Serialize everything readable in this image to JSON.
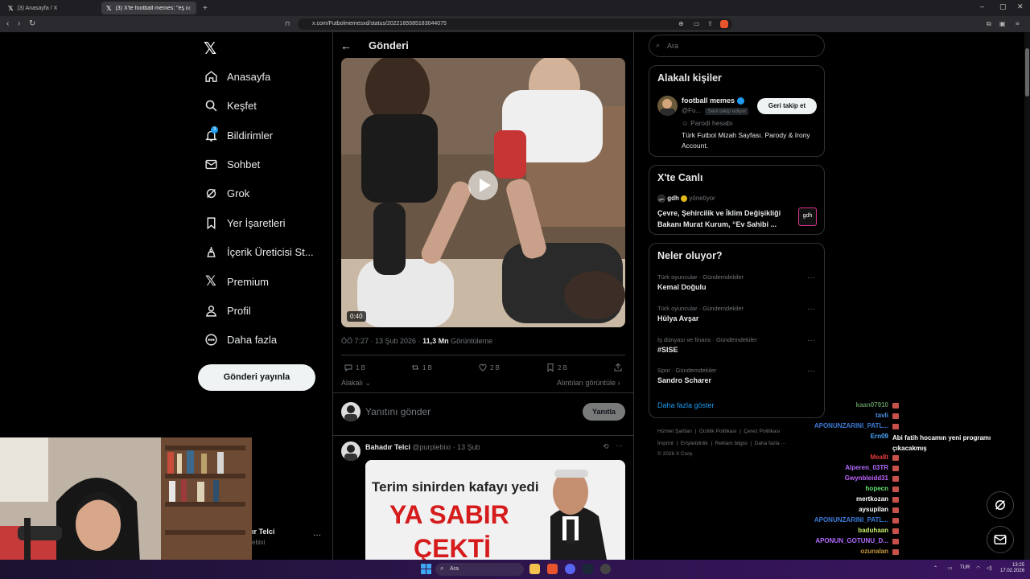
{
  "browser": {
    "tabs": [
      {
        "title": "(3) Anasayfa / X"
      },
      {
        "title": "(3) X'te football memes: \"eş değ..."
      }
    ],
    "url": "x.com/Futbolmemesxd/status/2022165585183044075"
  },
  "nav": {
    "items": [
      {
        "label": "Anasayfa",
        "icon": "home-icon"
      },
      {
        "label": "Keşfet",
        "icon": "search-icon"
      },
      {
        "label": "Bildirimler",
        "icon": "bell-icon"
      },
      {
        "label": "Sohbet",
        "icon": "mail-icon"
      },
      {
        "label": "Grok",
        "icon": "grok-icon"
      },
      {
        "label": "Yer İşaretleri",
        "icon": "bookmark-icon"
      },
      {
        "label": "İçerik Üreticisi St...",
        "icon": "creator-icon"
      },
      {
        "label": "Premium",
        "icon": "x-logo-icon"
      },
      {
        "label": "Profil",
        "icon": "person-icon"
      },
      {
        "label": "Daha fazla",
        "icon": "more-circle-icon"
      }
    ],
    "notification_count": "3",
    "post_button": "Gönderi yayınla",
    "account_name": "ır Telci",
    "account_handle": "ebixi"
  },
  "post": {
    "header": "Gönderi",
    "video_duration": "0:40",
    "time": "ÖÖ 7:27 · 13 Şub 2026 ·",
    "views": "11,3 Mn",
    "views_label": "Görüntüleme",
    "replies": "1 B",
    "reposts": "1 B",
    "likes": "2 B",
    "bookmarks": "2 B",
    "sort_label": "Alakalı",
    "quotes_link": "Alıntıları görüntüle",
    "reply_placeholder": "Yanıtını gönder",
    "reply_button": "Yanıtla"
  },
  "reply_tweet": {
    "name": "Bahadır Telci",
    "handle": "@purplebixi",
    "date": "· 13 Şub",
    "image_headline": "Terim sinirden kafayı yedi",
    "image_big": "YA SABIR",
    "image_big2": "ÇEKTİ"
  },
  "sidebar": {
    "search_placeholder": "Ara",
    "related_title": "Alakalı kişiler",
    "related": {
      "name": "football memes",
      "handle": "@Fu...",
      "follows_you": "Seni takip ediyor",
      "follow_button": "Geri takip et",
      "parody": "Parodi hesabı",
      "bio": "Türk Futbol Mizah Sayfası. Parody & Irony Account."
    },
    "live_title": "X'te Canlı",
    "live": {
      "host": "gdh",
      "host_suffix": "yönetiyor",
      "title": "Çevre, Şehircilik ve İklim Değişikliği Bakanı Murat Kurum, “Ev Sahibi ...",
      "thumb": "gdh"
    },
    "trends_title": "Neler oluyor?",
    "trends": [
      {
        "category": "Türk oyuncular · Gündemdekiler",
        "name": "Kemal Doğulu"
      },
      {
        "category": "Türk oyuncular · Gündemdekiler",
        "name": "Hülya Avşar"
      },
      {
        "category": "İş dünyası ve finans · Gündemdekiler",
        "name": "#SISE"
      },
      {
        "category": "Spor · Gündemdekiler",
        "name": "Sandro Scharer"
      }
    ],
    "show_more": "Daha fazla göster",
    "footer": {
      "line1": [
        "Hizmet Şartları",
        "Gizlilik Politikası",
        "Çerez Politikası"
      ],
      "line2": [
        "İmprint",
        "Erişilebilirlik",
        "Reklam bilgisi",
        "Daha fazla ···"
      ],
      "copyright": "© 2026 X Corp."
    }
  },
  "chat": [
    {
      "user": "kaan07910",
      "color": "#5b8c5a",
      "msg": ""
    },
    {
      "user": "tavli",
      "color": "#4a90e2",
      "msg": ""
    },
    {
      "user": "APONUNZARINI_PATL...",
      "color": "#3d7bd9",
      "msg": ""
    },
    {
      "user": "Ern09",
      "color": "#4aa8ff",
      "msg": "Abi fatih hocamın yeni programı çıkacakmış"
    },
    {
      "user": "Mea8t",
      "color": "#e03a3a",
      "msg": ""
    },
    {
      "user": "Alperen_03TR",
      "color": "#b36bff",
      "msg": ""
    },
    {
      "user": "Gwynbleidd31",
      "color": "#c266ff",
      "msg": ""
    },
    {
      "user": "hopecn",
      "color": "#5fe36f",
      "msg": ""
    },
    {
      "user": "mertkozan",
      "color": "#ffffff",
      "msg": ""
    },
    {
      "user": "aysupilan",
      "color": "#ffffff",
      "msg": ""
    },
    {
      "user": "APONUNZARINI_PATL...",
      "color": "#3d7bd9",
      "msg": ""
    },
    {
      "user": "baduhaan",
      "color": "#c6f06a",
      "msg": ""
    },
    {
      "user": "APONUN_GOTUNU_D...",
      "color": "#b36bff",
      "msg": ""
    },
    {
      "user": "ozunalan",
      "color": "#c59a3d",
      "msg": ""
    }
  ],
  "taskbar": {
    "search_placeholder": "Ara",
    "lang": "TUR",
    "time": "13:25",
    "date": "17.02.2026"
  }
}
